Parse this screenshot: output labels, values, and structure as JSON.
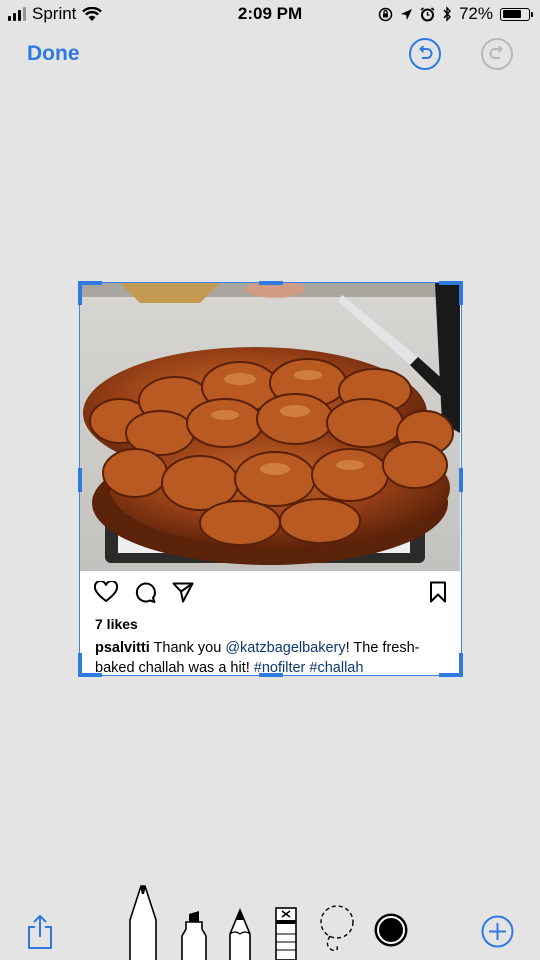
{
  "status": {
    "carrier": "Sprint",
    "time": "2:09 PM",
    "battery": "72%",
    "battery_level": 0.72
  },
  "header": {
    "done_label": "Done"
  },
  "post": {
    "likes": "7 likes",
    "username": "psalvitti",
    "caption_text_1": " Thank you ",
    "mention": "@katzbagelbakery",
    "caption_text_2": "! The fresh-baked challah was a hit! ",
    "hashtag_1": "#nofilter",
    "hashtag_2": "#challah"
  },
  "icons": {
    "undo": "undo-icon",
    "redo": "redo-icon",
    "like": "heart-icon",
    "comment": "comment-icon",
    "share": "send-icon",
    "save": "bookmark-icon",
    "export": "share-icon",
    "add": "plus-icon"
  },
  "tools": [
    "pen",
    "marker",
    "pencil",
    "eraser",
    "lasso",
    "color"
  ],
  "colors": {
    "accent": "#2f7ae0",
    "disabled": "#b8b8b8",
    "background": "#e4e4e4",
    "tag": "#0b3a72"
  }
}
